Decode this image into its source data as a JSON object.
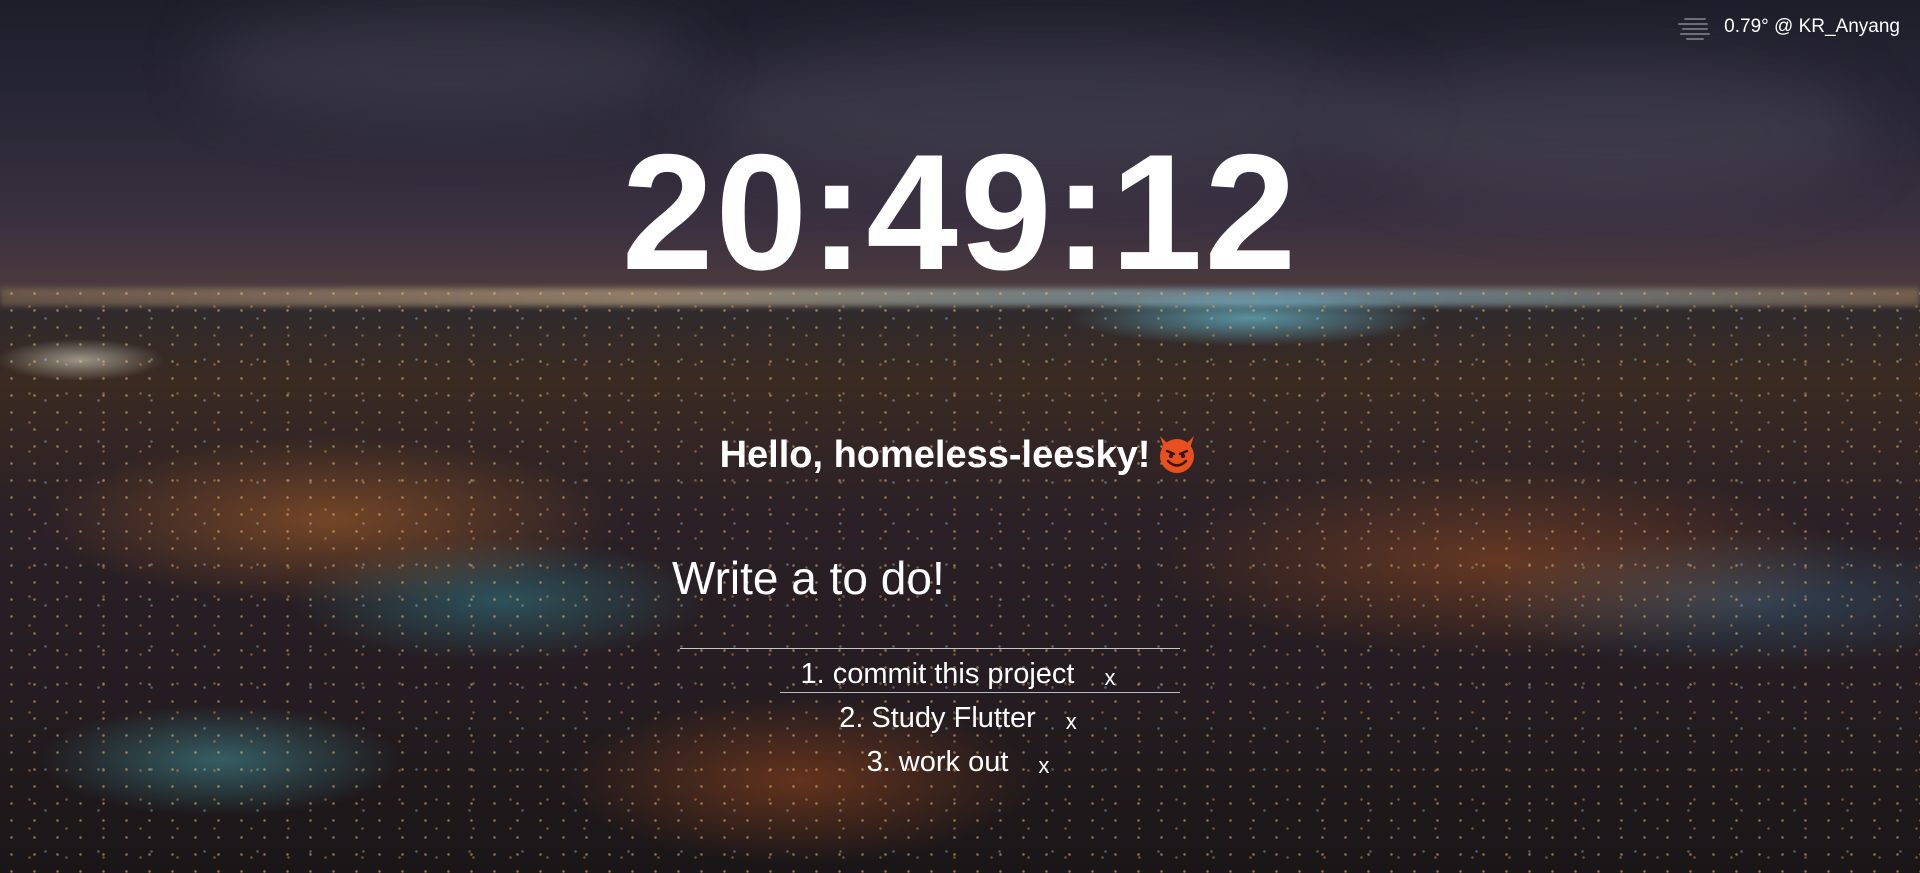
{
  "weather": {
    "icon": "fog-icon",
    "text": "0.79° @ KR_Anyang"
  },
  "clock": {
    "time": "20:49:12"
  },
  "greeting": {
    "text": "Hello, homeless-leesky!",
    "emoji_icon": "smiling-devil-icon"
  },
  "todo_form": {
    "placeholder": "Write a to do!",
    "value": ""
  },
  "todos": [
    {
      "index": "1.",
      "text": "commit this project",
      "delete_label": "x"
    },
    {
      "index": "2.",
      "text": "Study Flutter",
      "delete_label": "x"
    },
    {
      "index": "3.",
      "text": "work out",
      "delete_label": "x"
    }
  ],
  "colors": {
    "text": "#ffffff",
    "devil_face": "#e8501e"
  }
}
